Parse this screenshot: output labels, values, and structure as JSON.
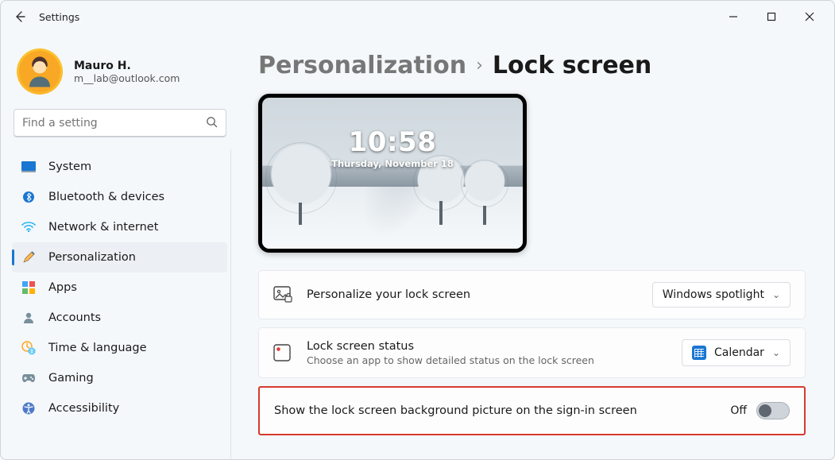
{
  "app": {
    "title": "Settings"
  },
  "user": {
    "name": "Mauro H.",
    "email": "m__lab@outlook.com"
  },
  "search": {
    "placeholder": "Find a setting"
  },
  "sidebar": {
    "items": [
      {
        "label": "System",
        "icon": "display-icon"
      },
      {
        "label": "Bluetooth & devices",
        "icon": "bluetooth-icon"
      },
      {
        "label": "Network & internet",
        "icon": "wifi-icon"
      },
      {
        "label": "Personalization",
        "icon": "paintbrush-icon",
        "active": true
      },
      {
        "label": "Apps",
        "icon": "apps-icon"
      },
      {
        "label": "Accounts",
        "icon": "person-icon"
      },
      {
        "label": "Time & language",
        "icon": "clock-globe-icon"
      },
      {
        "label": "Gaming",
        "icon": "gamepad-icon"
      },
      {
        "label": "Accessibility",
        "icon": "accessibility-icon"
      }
    ]
  },
  "breadcrumb": {
    "parent": "Personalization",
    "current": "Lock screen"
  },
  "preview": {
    "time": "10:58",
    "date": "Thursday, November 18"
  },
  "cards": {
    "personalize": {
      "title": "Personalize your lock screen",
      "dropdown_value": "Windows spotlight"
    },
    "status": {
      "title": "Lock screen status",
      "subtitle": "Choose an app to show detailed status on the lock screen",
      "dropdown_value": "Calendar"
    },
    "signin_bg": {
      "title": "Show the lock screen background picture on the sign-in screen",
      "toggle_label": "Off",
      "toggle_state": "off"
    }
  }
}
